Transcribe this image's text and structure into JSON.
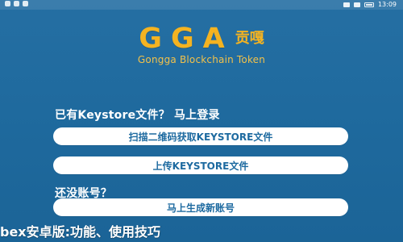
{
  "status_bar": {
    "time": "13:09"
  },
  "logo": {
    "text": "GGA",
    "cn": "贡嘎",
    "subtitle": "Gongga Blockchain Token"
  },
  "keystore_section": {
    "title": "已有Keystore文件？ 马上登录",
    "scan_button_label": "扫描二维码获取KEYSTORE文件",
    "upload_button_label": "上传KEYSTORE文件"
  },
  "register_section": {
    "title": "还没账号？",
    "create_button_label": "马上生成新账号"
  },
  "overlay": {
    "text": "bex安卓版:功能、使用技巧"
  },
  "colors": {
    "background": "#1f6a9e",
    "accent_gold": "#f4b321",
    "button_bg": "#ffffff",
    "button_text": "#1d6aa0"
  }
}
